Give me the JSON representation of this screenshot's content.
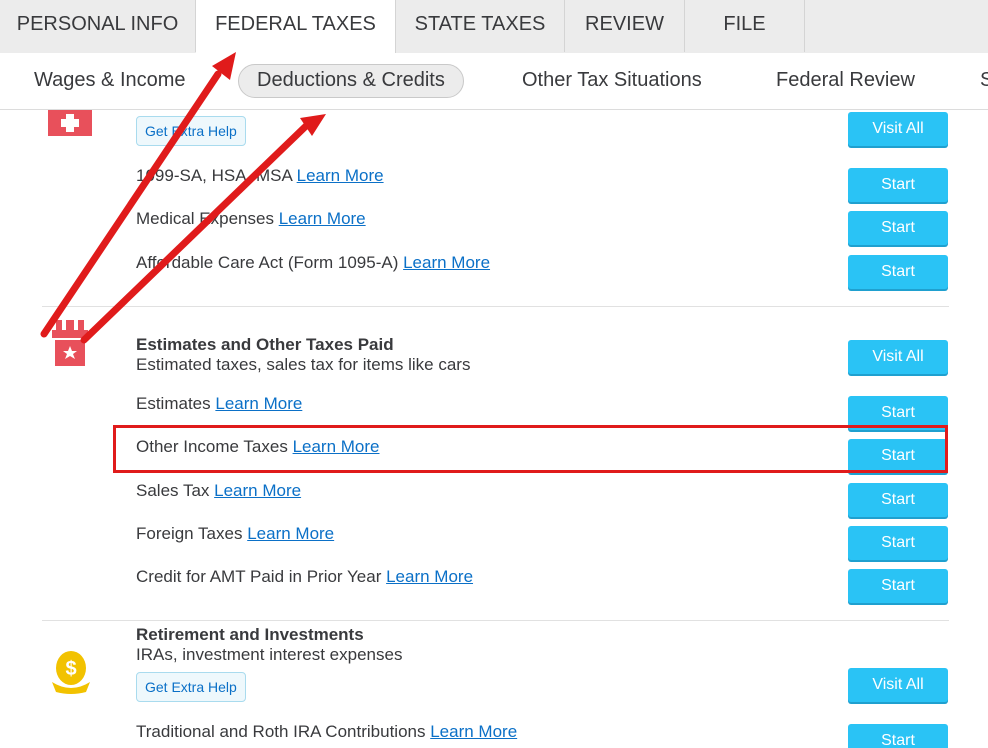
{
  "top_tabs": [
    {
      "label": "PERSONAL INFO"
    },
    {
      "label": "FEDERAL TAXES"
    },
    {
      "label": "STATE TAXES"
    },
    {
      "label": "REVIEW"
    },
    {
      "label": "FILE"
    }
  ],
  "sub_nav": [
    {
      "label": "Wages & Income"
    },
    {
      "label": "Deductions & Credits"
    },
    {
      "label": "Other Tax Situations"
    },
    {
      "label": "Federal Review"
    },
    {
      "label": "S"
    }
  ],
  "learn_more": "Learn More",
  "health": {
    "help_label": "Get Extra Help",
    "visit_all": "Visit All",
    "rows": [
      {
        "label": "1099-SA, HSA, MSA",
        "button": "Start"
      },
      {
        "label": "Medical Expenses",
        "button": "Start"
      },
      {
        "label": "Affordable Care Act (Form 1095-A)",
        "button": "Start"
      }
    ]
  },
  "estimates": {
    "title": "Estimates and Other Taxes Paid",
    "subtitle": "Estimated taxes, sales tax for items like cars",
    "visit_all": "Visit All",
    "rows": [
      {
        "label": "Estimates",
        "button": "Start"
      },
      {
        "label": "Other Income Taxes",
        "button": "Start"
      },
      {
        "label": "Sales Tax",
        "button": "Start"
      },
      {
        "label": "Foreign Taxes",
        "button": "Start"
      },
      {
        "label": "Credit for AMT Paid in Prior Year",
        "button": "Start"
      }
    ]
  },
  "retirement": {
    "title": "Retirement and Investments",
    "subtitle": "IRAs, investment interest expenses",
    "help_label": "Get Extra Help",
    "visit_all": "Visit All",
    "rows": [
      {
        "label": "Traditional and Roth IRA Contributions",
        "button": "Start"
      }
    ]
  },
  "annotations": {
    "arrow_color": "#e01b1b",
    "box_color": "#e01b1b"
  },
  "icons": {
    "health": "medical-cross-icon",
    "estimates": "gift-box-icon",
    "retirement": "money-bag-icon"
  }
}
